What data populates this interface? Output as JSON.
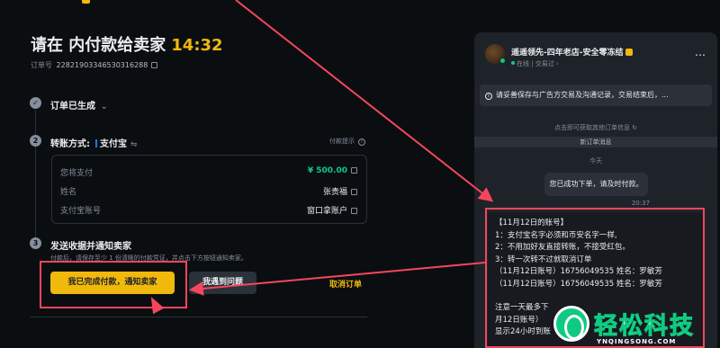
{
  "colors": {
    "accent": "#f0b90b",
    "green": "#0ecb81",
    "red": "#f6465d",
    "bg": "#0b0e11",
    "panel": "#1e2329"
  },
  "header": {
    "title": "请在 内付款给卖家",
    "timer": "14:32",
    "order_label": "订单号",
    "order_number": "22821903346530316288"
  },
  "steps": [
    {
      "num": "",
      "label": "订单已生成"
    },
    {
      "num": "2",
      "label": "转账方式:",
      "method": "支付宝",
      "hint": "付款提示"
    },
    {
      "num": "3",
      "label": "发送收据并通知卖家",
      "desc": "付款后，请保存至少 1 份清晰的付款凭证，并点击下方按钮通知卖家。"
    }
  ],
  "payment_info": [
    {
      "label": "您将支付",
      "value": "¥ 500.00"
    },
    {
      "label": "姓名",
      "value": "张贵福"
    },
    {
      "label": "支付宝账号",
      "value": "窗口拿账户"
    }
  ],
  "actions": {
    "primary": "我已完成付款，通知卖家",
    "secondary": "我遇到问题",
    "cancel": "取消订单"
  },
  "chat": {
    "merchant_name": "遥遥领先-四年老店-安全零冻结",
    "status": "在线",
    "trade_link": "交易过",
    "notice": "请妥善保存与广告方交易及沟通记录，交易结束后，...",
    "history": "点击即可获取其他订单信息",
    "new_messages": "新订单消息",
    "today": "今天",
    "system_message": "您已成功下单，请及时付款。",
    "system_time": "20:37",
    "message_lines": [
      "【11月12日的账号】",
      "1：支付宝名字必须和币安名字一样,",
      "2：不用加好友直接转账，不接受红包。",
      "3：转一次转不过就取消订单",
      "（11月12日账号）16756049535 姓名：罗敏芳",
      "（11月12日账号）16756049535 姓名：罗敏芳",
      "",
      "注意一天最多下",
      "月12日账号）",
      "显示24小时到账"
    ]
  },
  "watermark": {
    "text": "轻松科技",
    "sub": "YNQINGSONG.COM"
  }
}
